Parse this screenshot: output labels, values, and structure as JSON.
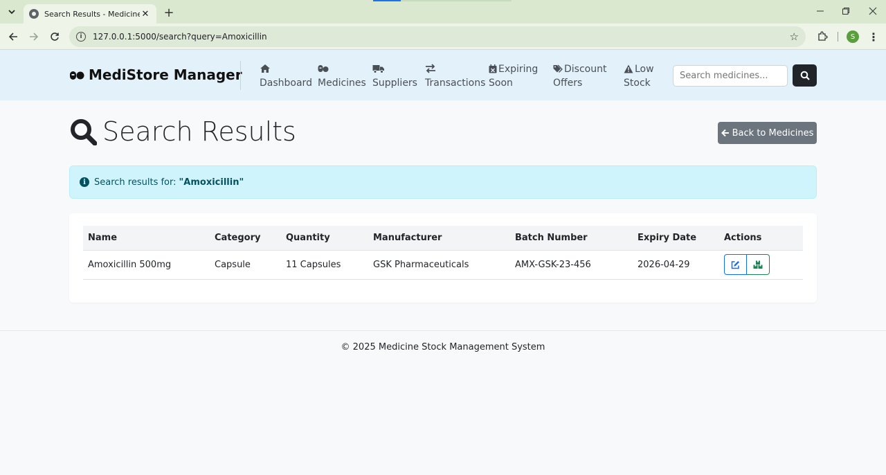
{
  "browser": {
    "tab_title": "Search Results - Medicine Stock",
    "url": "127.0.0.1:5000/search?query=Amoxicillin",
    "profile_initial": "S"
  },
  "navbar": {
    "brand": "MediStore Manager",
    "items": [
      {
        "label": "Dashboard",
        "icon": "home-icon"
      },
      {
        "label": "Medicines",
        "icon": "pills-icon"
      },
      {
        "label": "Suppliers",
        "icon": "truck-icon"
      },
      {
        "label": "Transactions",
        "icon": "exchange-icon"
      },
      {
        "label_line1": "Expiring",
        "label_line2": "Soon",
        "icon": "calendar-x-icon"
      },
      {
        "label_line1": "Discount",
        "label_line2": "Offers",
        "icon": "tags-icon"
      },
      {
        "label_line1": "Low",
        "label_line2": "Stock",
        "icon": "warning-icon"
      }
    ],
    "search_placeholder": "Search medicines..."
  },
  "page": {
    "title": "Search Results",
    "back_button": "Back to Medicines",
    "alert_prefix": "Search results for:",
    "alert_query": "\"Amoxicillin\""
  },
  "table": {
    "headers": [
      "Name",
      "Category",
      "Quantity",
      "Manufacturer",
      "Batch Number",
      "Expiry Date",
      "Actions"
    ],
    "rows": [
      {
        "name": "Amoxicillin 500mg",
        "category": "Capsule",
        "quantity": "11 Capsules",
        "manufacturer": "GSK Pharmaceuticals",
        "batch": "AMX-GSK-23-456",
        "expiry": "2026-04-29"
      }
    ]
  },
  "footer": {
    "text": "© 2025 Medicine Stock Management System"
  },
  "colors": {
    "navbar_bg": "#e3f1fb",
    "alert_bg": "#cff4fc",
    "alert_text": "#055160",
    "back_button_bg": "#6c757d",
    "edit_blue": "#0d6efd",
    "stock_green": "#198754"
  }
}
